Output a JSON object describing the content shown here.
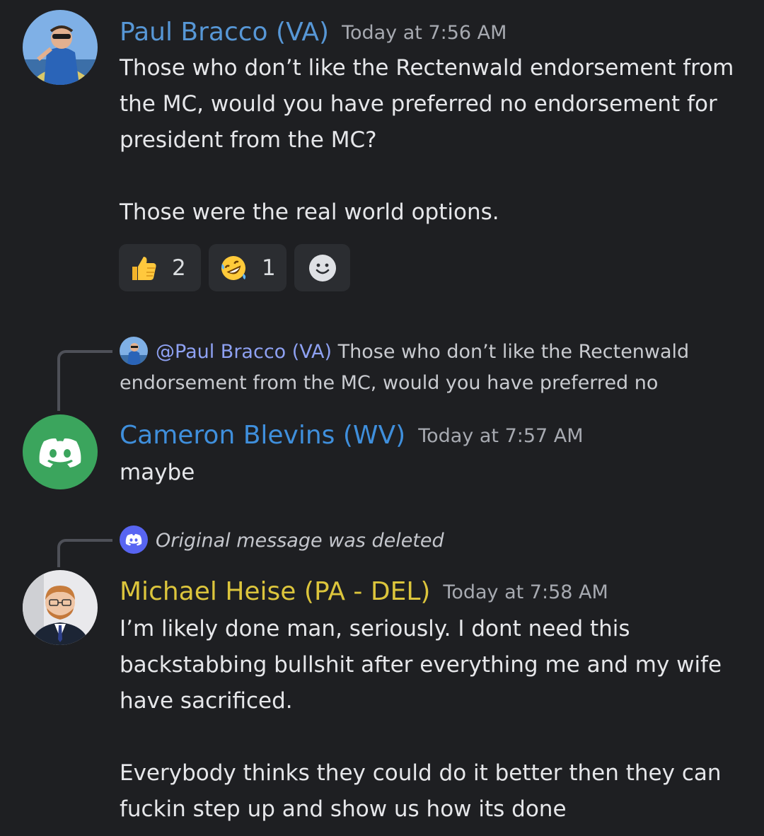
{
  "colors": {
    "background": "#1e1f22",
    "paul_name": "#5797d6",
    "cameron_name": "#3f8fdc",
    "michael_name": "#dcc53c",
    "discord_green": "#3ba55d",
    "discord_blurple": "#5865f2"
  },
  "messages": [
    {
      "author": "Paul Bracco (VA)",
      "timestamp": "Today at 7:56 AM",
      "text": "Those who don’t like the Rectenwald endorsement from the MC, would you have preferred no endorsement for president from the MC?\n\nThose were the real world options.",
      "reactions": [
        {
          "emoji": "thumbs-up-icon",
          "count": "2"
        },
        {
          "emoji": "rofl-icon",
          "count": "1"
        }
      ],
      "add_reaction_icon": "add-reaction-icon"
    },
    {
      "reply": {
        "mention": "@Paul Bracco (VA)",
        "text": " Those who don’t like the Rectenwald endorsement from the MC, would you have preferred no"
      },
      "author": "Cameron Blevins (WV)",
      "timestamp": "Today at 7:57 AM",
      "text": "maybe"
    },
    {
      "reply": {
        "deleted_text": "Original message was deleted"
      },
      "author": "Michael Heise (PA - DEL)",
      "timestamp": "Today at 7:58 AM",
      "text": "I’m likely done man, seriously. I dont need this backstabbing bullshit after everything me and my wife have sacrificed.\n\nEverybody thinks they could do it better then they can fuckin step up and show us how its done"
    }
  ]
}
